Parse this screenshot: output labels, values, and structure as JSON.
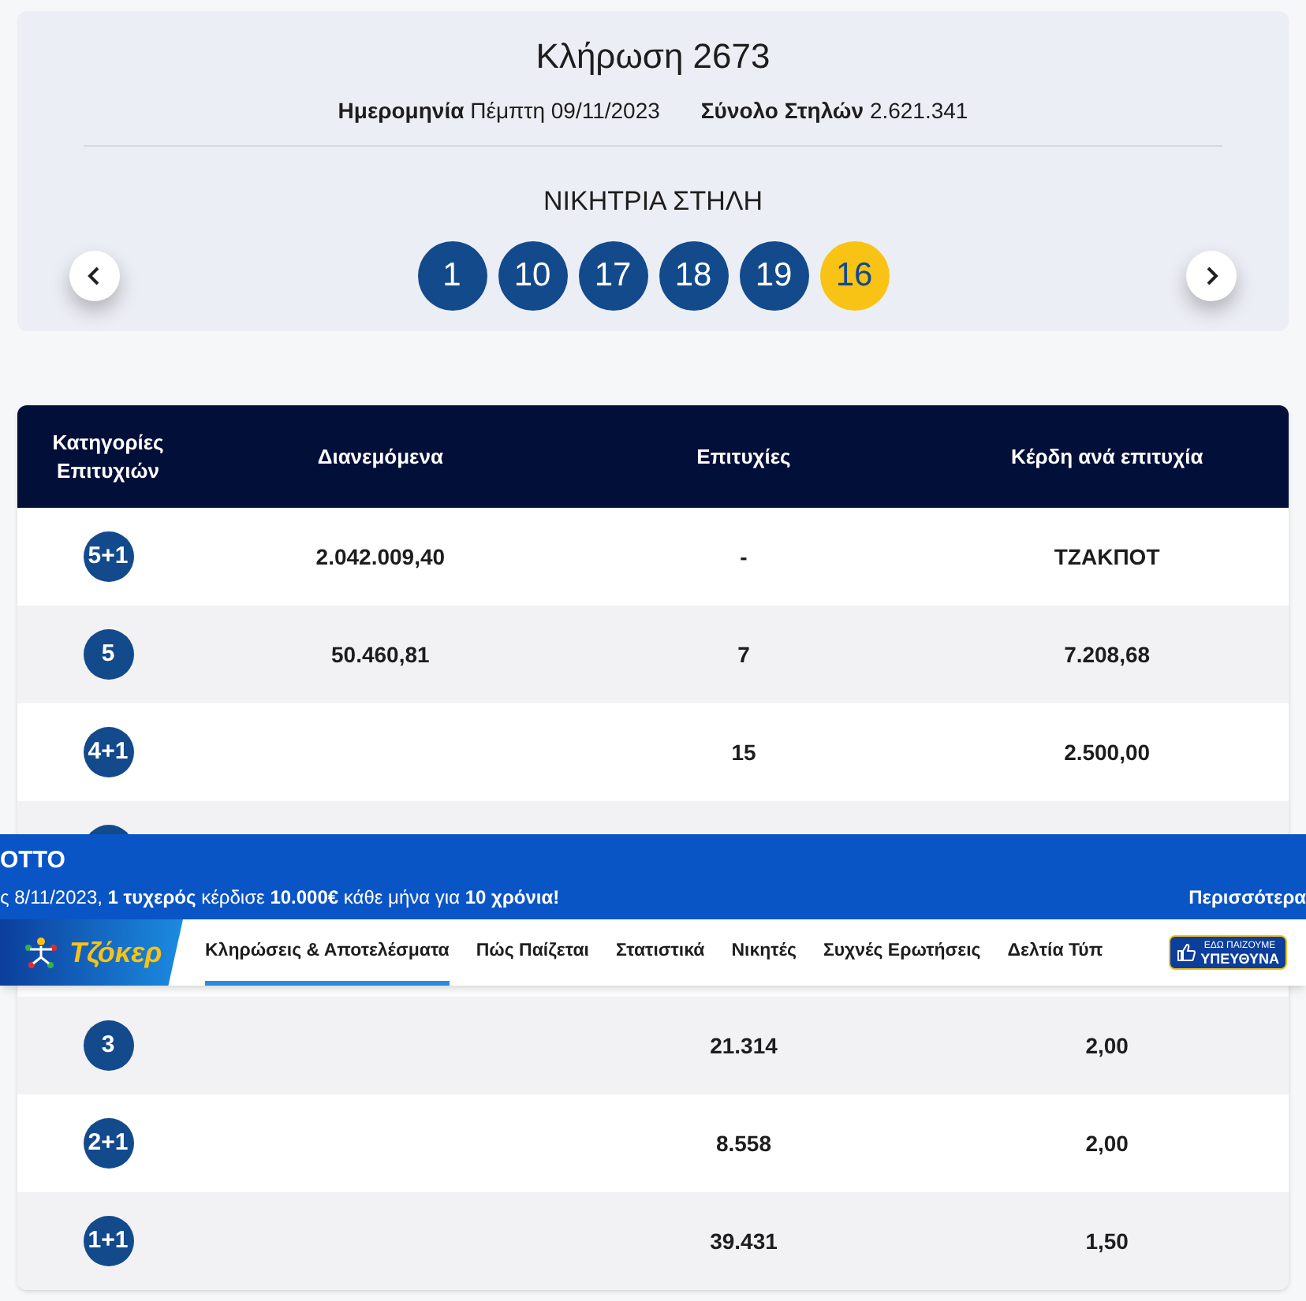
{
  "draw": {
    "title": "Κλήρωση 2673",
    "date_label": "Ημερομηνία",
    "date_value": "Πέμπτη 09/11/2023",
    "total_label": "Σύνολο Στηλών",
    "total_value": "2.621.341",
    "winning_title": "ΝΙΚΗΤΡΙΑ ΣΤΗΛΗ",
    "numbers": [
      {
        "value": "1",
        "kind": "main"
      },
      {
        "value": "10",
        "kind": "main"
      },
      {
        "value": "17",
        "kind": "main"
      },
      {
        "value": "18",
        "kind": "main"
      },
      {
        "value": "19",
        "kind": "main"
      },
      {
        "value": "16",
        "kind": "joker"
      }
    ]
  },
  "table": {
    "columns": [
      "Κατηγορίες Επιτυχιών",
      "Διανεμόμενα",
      "Επιτυχίες",
      "Κέρδη ανά επιτυχία"
    ],
    "rows": [
      {
        "category": "5+1",
        "distributed": "2.042.009,40",
        "winners": "-",
        "prize": "ΤΖΑΚΠΟΤ"
      },
      {
        "category": "5",
        "distributed": "50.460,81",
        "winners": "7",
        "prize": "7.208,68"
      },
      {
        "category": "4+1",
        "winners": "15",
        "prize": "2.500,00"
      }
    ],
    "rows_below": [
      {
        "category": "3",
        "winners": "21.314",
        "prize": "2,00"
      },
      {
        "category": "2+1",
        "winners": "8.558",
        "prize": "2,00"
      },
      {
        "category": "1+1",
        "winners": "39.431",
        "prize": "1,50"
      }
    ]
  },
  "banner": {
    "title": "ΟΤΤΟ",
    "message": "ς 8/11/2023, **1 τυχερός** κέρδισε **10.000€** κάθε μήνα για **10 χρόνια!**",
    "more": "Περισσότερα"
  },
  "nav": {
    "logo": "Τζόκερ",
    "items": [
      {
        "label": "Κληρώσεις & Αποτελέσματα",
        "selected": true
      },
      {
        "label": "Πώς Παίζεται",
        "selected": false
      },
      {
        "label": "Στατιστικά",
        "selected": false
      },
      {
        "label": "Νικητές",
        "selected": false
      },
      {
        "label": "Συχνές Ερωτήσεις",
        "selected": false
      },
      {
        "label": "Δελτία Τύπ",
        "selected": false
      }
    ],
    "badge_top": "ΕΔΩ ΠΑΙΖΟΥΜΕ",
    "badge_bottom": "ΥΠΕΥΘΥΝΑ"
  }
}
